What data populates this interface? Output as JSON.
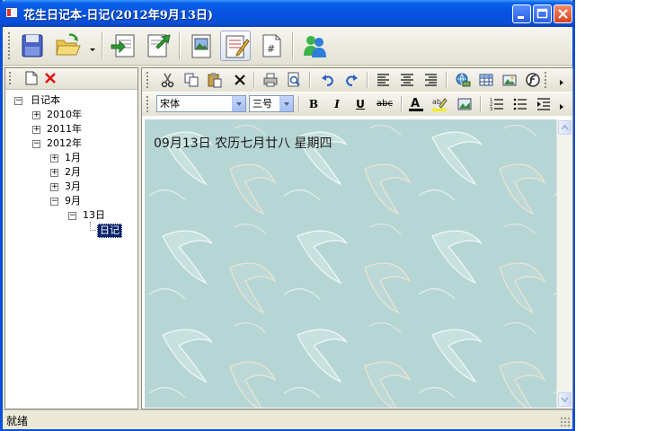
{
  "window": {
    "title": "花生日记本-日记(2012年9月13日)"
  },
  "toolbar": {
    "icons": [
      "save-icon",
      "open-folder-icon",
      "import-icon",
      "export-icon",
      "picture-view-icon",
      "edit-note-icon",
      "number-page-icon",
      "users-icon"
    ]
  },
  "tree": {
    "root": "日记本",
    "years": [
      "2010年",
      "2011年",
      "2012年"
    ],
    "months": [
      "1月",
      "2月",
      "3月",
      "9月"
    ],
    "day": "13日",
    "entry": "日记"
  },
  "format": {
    "font_family": "宋体",
    "font_size": "三号",
    "bold": "B",
    "italic": "I",
    "underline": "U",
    "strike": "abc"
  },
  "editor": {
    "content": "09月13日  农历七月廿八  星期四",
    "background_color": "#b5d6d4"
  },
  "status": {
    "text": "就绪"
  },
  "colors": {
    "titlebar": "#0a4fd8",
    "selection": "#0a246a",
    "close_button": "#d8421e"
  }
}
